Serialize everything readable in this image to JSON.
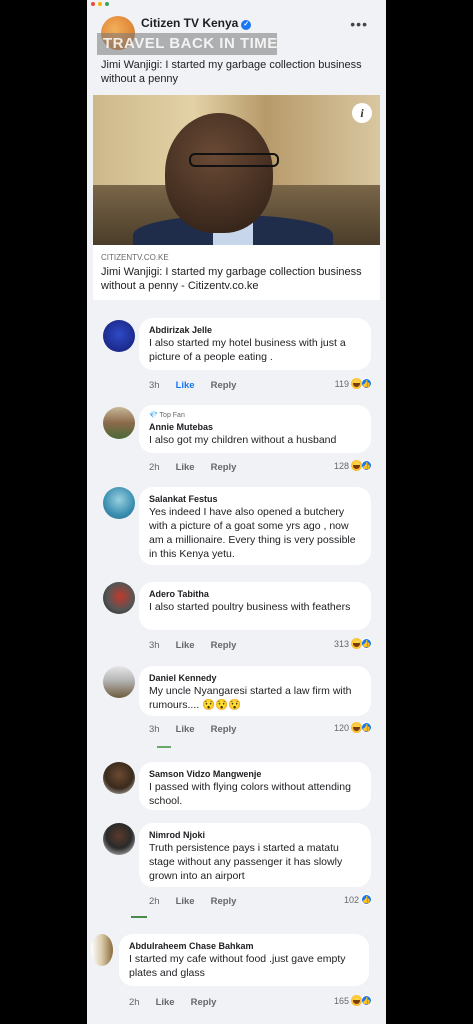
{
  "post": {
    "page_name": "Citizen TV Kenya",
    "overlay_text": "TRAVEL BACK IN TIME",
    "text": "Jimi Wanjigi: I started my garbage collection business without a penny",
    "link": {
      "domain": "CITIZENTV.CO.KE",
      "title": "Jimi Wanjigi: I started my garbage collection business without a penny - Citizentv.co.ke"
    }
  },
  "comments": [
    {
      "name": "Abdirizak Jelle",
      "badge": "",
      "text": "I also started my hotel business with just a picture of a people eating .",
      "time": "3h",
      "like": "Like",
      "reply": "Reply",
      "count": "119",
      "liked": true
    },
    {
      "name": "Annie Mutebas",
      "badge": "Top Fan",
      "text": "I also got my children without a husband",
      "time": "2h",
      "like": "Like",
      "reply": "Reply",
      "count": "128",
      "liked": false
    },
    {
      "name": "Salankat Festus",
      "badge": "",
      "text": "Yes indeed I have also opened a butchery with a picture of a goat some yrs ago , now am a millionaire. Every thing is very possible in this Kenya yetu.",
      "time": "",
      "like": "",
      "reply": "",
      "count": "",
      "liked": false
    },
    {
      "name": "Adero Tabitha",
      "badge": "",
      "text": "I also started poultry business with feathers",
      "time": "3h",
      "like": "Like",
      "reply": "Reply",
      "count": "313",
      "liked": false
    },
    {
      "name": "Daniel Kennedy",
      "badge": "",
      "text": "My uncle Nyangaresi started a law firm with rumours.... 😯😯😯",
      "time": "3h",
      "like": "Like",
      "reply": "Reply",
      "count": "120",
      "liked": false
    },
    {
      "name": "Samson Vidzo Mangwenje",
      "badge": "",
      "text": "I passed with flying colors without attending school.",
      "time": "",
      "like": "",
      "reply": "",
      "count": "",
      "liked": false
    },
    {
      "name": "Nimrod Njoki",
      "badge": "",
      "text": "Truth persistence pays i started a matatu stage without any passenger it has slowly grown into an airport",
      "time": "2h",
      "like": "Like",
      "reply": "Reply",
      "count": "102",
      "liked": false
    },
    {
      "name": "Abdulraheem Chase Bahkam",
      "badge": "",
      "text": "I started my cafe without food .just gave empty plates and glass",
      "time": "2h",
      "like": "Like",
      "reply": "Reply",
      "count": "165",
      "liked": false
    }
  ],
  "colors": {
    "accent": "#1877f2",
    "background": "#f0f2f5"
  }
}
